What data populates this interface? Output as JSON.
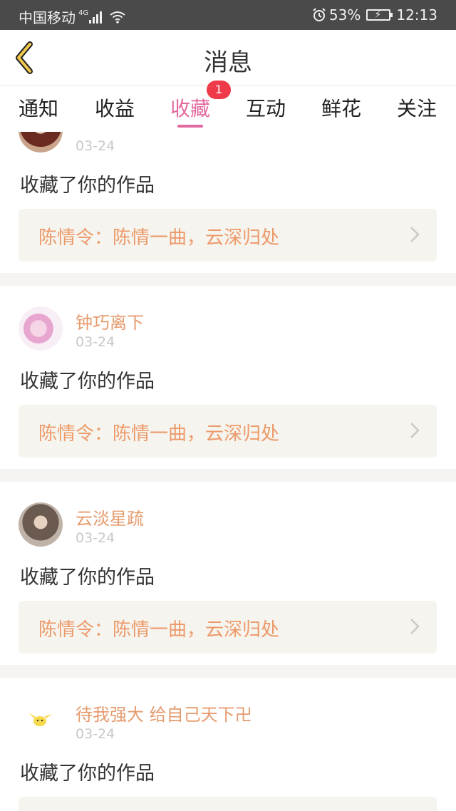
{
  "status_bar": {
    "carrier": "中国移动",
    "network": "4G",
    "battery": "53%",
    "time": "12:13"
  },
  "nav": {
    "back_icon": "chevron-left-icon",
    "title": "消息"
  },
  "tabs": {
    "items": [
      {
        "label": "通知"
      },
      {
        "label": "收益"
      },
      {
        "label": "收藏"
      },
      {
        "label": "互动"
      },
      {
        "label": "鲜花"
      },
      {
        "label": "关注"
      }
    ],
    "active_index": 2,
    "badge": "1"
  },
  "feed": {
    "items": [
      {
        "user": "",
        "time": "03-24",
        "action": "收藏了你的作品",
        "work_title": "陈情令：陈情一曲，云深归处"
      },
      {
        "user": "钟巧离下",
        "time": "03-24",
        "action": "收藏了你的作品",
        "work_title": "陈情令：陈情一曲，云深归处"
      },
      {
        "user": "云淡星疏",
        "time": "03-24",
        "action": "收藏了你的作品",
        "work_title": "陈情令：陈情一曲，云深归处"
      },
      {
        "user": "待我强大 给自己天下卍",
        "time": "03-24",
        "action": "收藏了你的作品",
        "work_title": ""
      }
    ]
  },
  "colors": {
    "accent_pink": "#e26a9f",
    "username_orange": "#e59b6e",
    "work_text_orange": "#ec9a6a",
    "badge_red": "#ef3a4a",
    "card_bg": "#f6f4ee"
  }
}
